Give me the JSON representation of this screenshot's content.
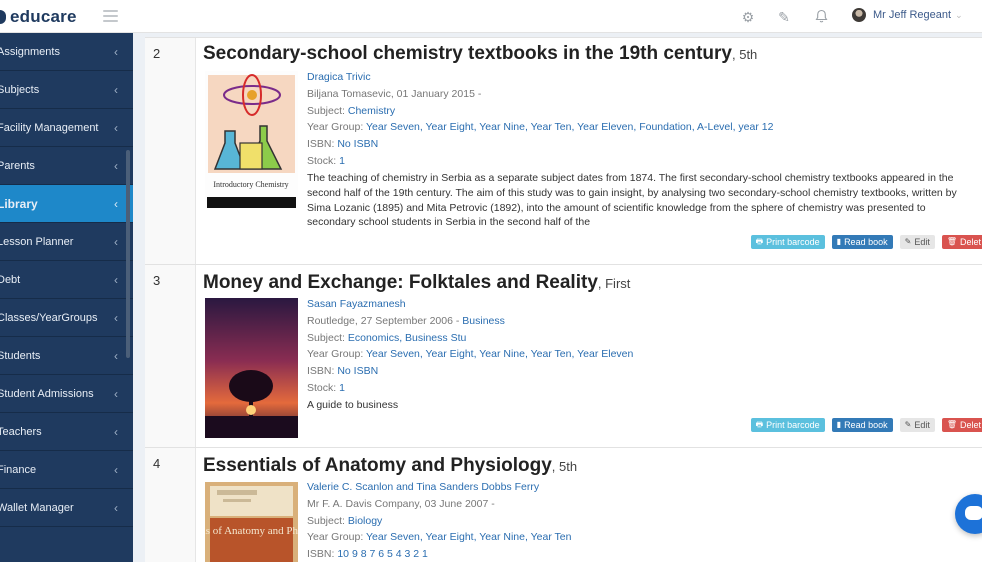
{
  "brand": {
    "name": "educare"
  },
  "topbar": {
    "icons": [
      "gear-icon",
      "edit-icon",
      "bell-icon"
    ],
    "user_name": "Mr Jeff Regeant"
  },
  "sidebar": {
    "items": [
      {
        "label": "Assignments",
        "active": false
      },
      {
        "label": "Subjects",
        "active": false
      },
      {
        "label": "Facility Management",
        "active": false
      },
      {
        "label": "Parents",
        "active": false
      },
      {
        "label": "Library",
        "active": true
      },
      {
        "label": "Lesson Planner",
        "active": false
      },
      {
        "label": "Debt",
        "active": false
      },
      {
        "label": "Classes/YearGroups",
        "active": false
      },
      {
        "label": "Students",
        "active": false
      },
      {
        "label": "Student Admissions",
        "active": false
      },
      {
        "label": "Teachers",
        "active": false
      },
      {
        "label": "Finance",
        "active": false
      },
      {
        "label": "Wallet Manager",
        "active": false
      }
    ]
  },
  "buttons": {
    "print": "Print barcode",
    "read": "Read book",
    "edit": "Edit",
    "delete": "Delet"
  },
  "books": [
    {
      "number": "2",
      "title": "Secondary-school chemistry textbooks in the 19th century",
      "edition": ", 5th",
      "author": "Dragica Trivic",
      "publisher_line": "Biljana Tomasevic, 01 January 2015 -",
      "publisher_category": "",
      "subject_label": "Subject: ",
      "subject": "Chemistry",
      "year_group_label": "Year Group: ",
      "year_groups": "Year Seven, Year Eight, Year Nine, Year Ten, Year Eleven, Foundation, A-Level, year 12",
      "isbn_label": "ISBN: ",
      "isbn": "No ISBN",
      "stock_label": "Stock: ",
      "stock": "1",
      "description": "The teaching of chemistry in Serbia as a separate subject dates from 1874. The first secondary-school chemistry textbooks appeared in the second half of the 19th century. The aim of this study was to gain insight, by analysing two secondary-school chemistry textbooks, written by Sima Lozanic (1895) and Mita Petrovic (1892), into the amount of scientific knowledge from the sphere of chemistry was presented to secondary school students in Serbia in the second half of the",
      "cover_caption": "Introductory Chemistry"
    },
    {
      "number": "3",
      "title": "Money and Exchange: Folktales and Reality",
      "edition": ", First",
      "author": "Sasan Fayazmanesh",
      "publisher_line": "Routledge, 27 September 2006 - ",
      "publisher_category": "Business",
      "subject_label": "Subject: ",
      "subject": "Economics, Business Stu",
      "year_group_label": "Year Group: ",
      "year_groups": "Year Seven, Year Eight, Year Nine, Year Ten, Year Eleven",
      "isbn_label": "ISBN: ",
      "isbn": "No ISBN",
      "stock_label": "Stock: ",
      "stock": "1",
      "description": "A guide to business"
    },
    {
      "number": "4",
      "title": "Essentials of Anatomy and Physiology",
      "edition": ", 5th",
      "author": "Valerie C. Scanlon and Tina Sanders Dobbs Ferry",
      "publisher_line": "Mr F. A. Davis Company, 03 June 2007 -",
      "publisher_category": "",
      "subject_label": "Subject: ",
      "subject": "Biology",
      "year_group_label": "Year Group: ",
      "year_groups": "Year Seven, Year Eight, Year Nine, Year Ten",
      "isbn_label": "ISBN: ",
      "isbn": "10 9 8 7 6 5 4 3 2 1",
      "cover_title": "Essentials of Anatomy and Physiology"
    }
  ]
}
